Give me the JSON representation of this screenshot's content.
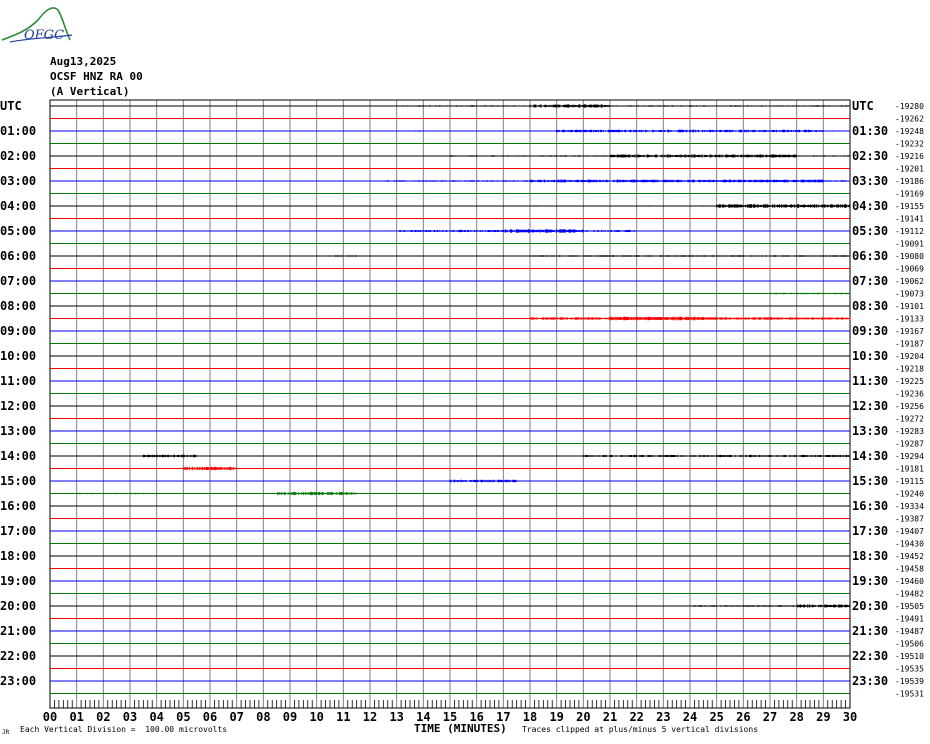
{
  "header": {
    "date": "Aug13,2025",
    "station": "OCSF HNZ RA 00",
    "component": "(A Vertical)"
  },
  "logo": {
    "text": "OFGC",
    "icon": "mountain-logo-icon",
    "accent": "#2e8b3a",
    "text_color": "#2040a0"
  },
  "colors": {
    "black": "#000000",
    "red": "#ff0000",
    "blue": "#0000ff",
    "green": "#007a00",
    "grid": "#808080"
  },
  "footer": {
    "division_note": "Each Vertical Division =  100.00 microvolts",
    "clip_note": "Traces clipped at plus/minus 5 vertical divisions",
    "small_mark": "JR"
  },
  "chart_data": {
    "type": "line",
    "title": "",
    "xlabel": "TIME (MINUTES)",
    "ylabel": "UTC",
    "xlim": [
      0,
      30
    ],
    "x_ticks": [
      "00",
      "01",
      "02",
      "03",
      "04",
      "05",
      "06",
      "07",
      "08",
      "09",
      "10",
      "11",
      "12",
      "13",
      "14",
      "15",
      "16",
      "17",
      "18",
      "19",
      "20",
      "21",
      "22",
      "23",
      "24",
      "25",
      "26",
      "27",
      "28",
      "29",
      "30"
    ],
    "left_labels": [
      "UTC",
      "01:00",
      "02:00",
      "03:00",
      "04:00",
      "05:00",
      "06:00",
      "07:00",
      "08:00",
      "09:00",
      "10:00",
      "11:00",
      "12:00",
      "13:00",
      "14:00",
      "15:00",
      "16:00",
      "17:00",
      "18:00",
      "19:00",
      "20:00",
      "21:00",
      "22:00",
      "23:00"
    ],
    "right_labels": [
      "UTC",
      "01:30",
      "02:30",
      "03:30",
      "04:30",
      "05:30",
      "06:30",
      "07:30",
      "08:30",
      "09:30",
      "10:30",
      "11:30",
      "12:30",
      "13:30",
      "14:30",
      "15:30",
      "16:30",
      "17:30",
      "18:30",
      "19:30",
      "20:30",
      "21:30",
      "22:30",
      "23:30"
    ],
    "trace_colors": [
      "black",
      "red",
      "blue",
      "green"
    ],
    "trace_offsets": [
      "-19280",
      "-19262",
      "-19248",
      "-19232",
      "-19216",
      "-19201",
      "-19186",
      "-19169",
      "-19155",
      "-19141",
      "-19112",
      "-19091",
      "-19080",
      "-19069",
      "-19062",
      "-19073",
      "-19101",
      "-19133",
      "-19167",
      "-19187",
      "-19204",
      "-19218",
      "-19225",
      "-19236",
      "-19256",
      "-19272",
      "-19283",
      "-19287",
      "-19294",
      "-19181",
      "-19115",
      "-19240",
      "-19334",
      "-19387",
      "-19407",
      "-19430",
      "-19452",
      "-19458",
      "-19460",
      "-19482",
      "-19505",
      "-19491",
      "-19487",
      "-19506",
      "-19510",
      "-19535",
      "-19539",
      "-19531"
    ],
    "activity": [
      [
        [
          13.0,
          30,
          0.5
        ],
        [
          18,
          21,
          1.2
        ]
      ],
      [],
      [
        [
          12,
          30,
          0.4
        ],
        [
          19,
          29,
          1.0
        ]
      ],
      [],
      [
        [
          15,
          30,
          0.5
        ],
        [
          21,
          28,
          1.2
        ]
      ],
      [],
      [
        [
          12.5,
          30,
          0.6
        ],
        [
          18,
          29,
          1.1
        ]
      ],
      [],
      [
        [
          18,
          30,
          0.4
        ],
        [
          25,
          30,
          1.4
        ]
      ],
      [],
      [
        [
          13,
          22,
          0.8
        ],
        [
          17,
          20,
          1.3
        ]
      ],
      [],
      [
        [
          10.5,
          11.5,
          0.6
        ],
        [
          18,
          30,
          0.6
        ]
      ],
      [],
      [],
      [
        [
          27,
          30,
          0.6
        ]
      ],
      [],
      [
        [
          18,
          30,
          1.0
        ],
        [
          21,
          25,
          1.4
        ]
      ],
      [],
      [],
      [],
      [],
      [],
      [],
      [],
      [],
      [],
      [],
      [
        [
          3.5,
          5.5,
          1.0
        ],
        [
          20,
          30,
          0.8
        ]
      ],
      [
        [
          5,
          7,
          1.4
        ]
      ],
      [
        [
          15,
          17.5,
          1.0
        ]
      ],
      [
        [
          1,
          4,
          0.5
        ],
        [
          8.5,
          11.5,
          1.2
        ]
      ],
      [],
      [],
      [],
      [],
      [],
      [],
      [],
      [],
      [
        [
          24,
          30,
          0.6
        ],
        [
          28,
          30,
          1.2
        ]
      ],
      [],
      [],
      [],
      [],
      [],
      [],
      []
    ]
  }
}
